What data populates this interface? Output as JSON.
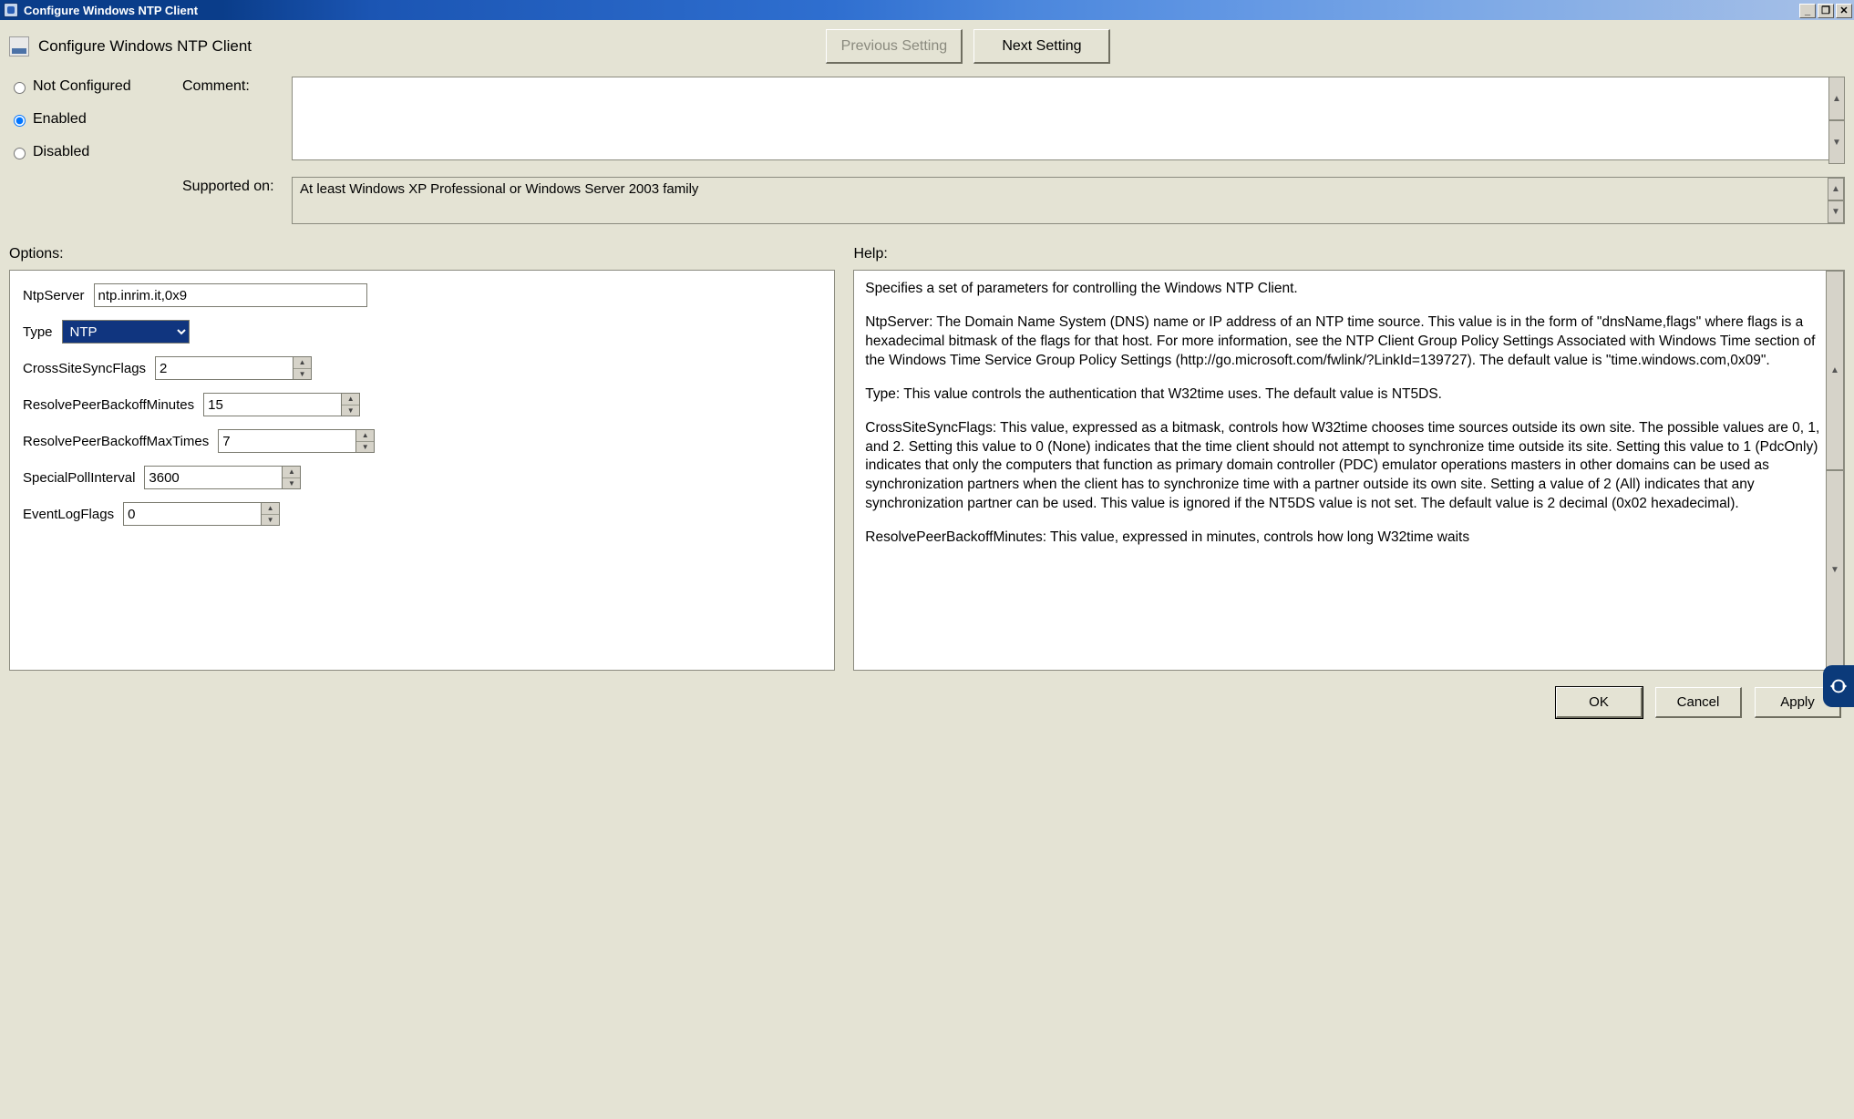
{
  "window": {
    "title": "Configure Windows NTP Client"
  },
  "header": {
    "policy_name": "Configure Windows NTP Client",
    "prev": "Previous Setting",
    "next": "Next Setting"
  },
  "state": {
    "not_configured": "Not Configured",
    "enabled": "Enabled",
    "disabled": "Disabled",
    "selected": "enabled",
    "comment_label": "Comment:",
    "comment_value": "",
    "supported_label": "Supported on:",
    "supported_value": "At least Windows XP Professional or Windows Server 2003 family"
  },
  "sections": {
    "options": "Options:",
    "help": "Help:"
  },
  "options": {
    "NtpServer": {
      "label": "NtpServer",
      "value": "ntp.inrim.it,0x9"
    },
    "Type": {
      "label": "Type",
      "value": "NTP"
    },
    "CrossSiteSyncFlags": {
      "label": "CrossSiteSyncFlags",
      "value": "2"
    },
    "ResolvePeerBackoffMinutes": {
      "label": "ResolvePeerBackoffMinutes",
      "value": "15"
    },
    "ResolvePeerBackoffMaxTimes": {
      "label": "ResolvePeerBackoffMaxTimes",
      "value": "7"
    },
    "SpecialPollInterval": {
      "label": "SpecialPollInterval",
      "value": "3600"
    },
    "EventLogFlags": {
      "label": "EventLogFlags",
      "value": "0"
    }
  },
  "help_text": {
    "p1": "Specifies a set of parameters for controlling the Windows NTP Client.",
    "p2": "NtpServer: The Domain Name System (DNS) name or IP address of an NTP time source. This value is in the form of \"dnsName,flags\" where flags is a hexadecimal bitmask of the flags for that host. For more information, see the NTP Client Group Policy Settings Associated with Windows Time section of the Windows Time Service Group Policy Settings (http://go.microsoft.com/fwlink/?LinkId=139727). The default value is \"time.windows.com,0x09\".",
    "p3": "Type: This value controls the authentication that W32time uses. The default value is NT5DS.",
    "p4": "CrossSiteSyncFlags: This value, expressed as a bitmask, controls how W32time chooses time sources outside its own site. The possible values are 0, 1, and 2. Setting this value to 0 (None) indicates that the time client should not attempt to synchronize time outside its site. Setting this value to 1 (PdcOnly) indicates that only the computers that function as primary domain controller (PDC) emulator operations masters in other domains can be used as synchronization partners when the client has to synchronize time with a partner outside its own site. Setting a value of 2 (All) indicates that any synchronization partner can be used. This value is ignored if the NT5DS value is not set. The default value is 2 decimal (0x02 hexadecimal).",
    "p5": "ResolvePeerBackoffMinutes: This value, expressed in minutes, controls how long W32time waits"
  },
  "buttons": {
    "ok": "OK",
    "cancel": "Cancel",
    "apply": "Apply"
  }
}
